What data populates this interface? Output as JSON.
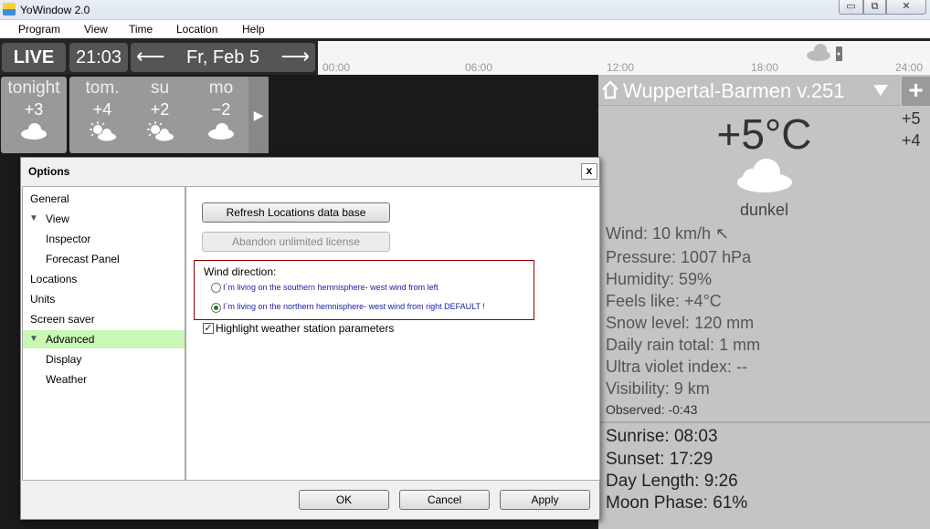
{
  "window": {
    "title": "YoWindow 2.0",
    "minimize": "▭",
    "maximize": "⧉",
    "close": "✕"
  },
  "menu": [
    "Program",
    "View",
    "Time",
    "Location",
    "Help"
  ],
  "controls": {
    "live": "LIVE",
    "time": "21:03",
    "date": "Fr, Feb 5",
    "prev_arrow": "⟵",
    "next_arrow": "⟶",
    "timeline_ticks": [
      "00:00",
      "06:00",
      "12:00",
      "18:00",
      "24:00"
    ]
  },
  "forecast": [
    {
      "name": "tonight",
      "temp": "+3",
      "icon": "cloud-icon"
    },
    {
      "name": "tom.",
      "temp": "+4",
      "icon": "sun-cloud-icon"
    },
    {
      "name": "su",
      "temp": "+2",
      "icon": "sun-cloud-icon"
    },
    {
      "name": "mo",
      "temp": "−2",
      "icon": "cloud-icon"
    }
  ],
  "forecast_next": "▶",
  "weather": {
    "location": "Wuppertal-Barmen v.251",
    "plus": "+",
    "side_temps": [
      "+5",
      "+4"
    ],
    "temperature": "+5°C",
    "description": "dunkel",
    "stats": [
      {
        "label": "Wind:",
        "value": "10 km/h ↖"
      },
      {
        "label": "Pressure:",
        "value": "1007 hPa"
      },
      {
        "label": "Humidity:",
        "value": "59%"
      },
      {
        "label": "Feels like:",
        "value": "+4°C"
      },
      {
        "label": "Snow level:",
        "value": "120 mm"
      },
      {
        "label": "Daily rain total:",
        "value": "1 mm"
      },
      {
        "label": "Ultra violet index:",
        "value": "--"
      },
      {
        "label": "Visibility:",
        "value": "9 km"
      }
    ],
    "observed": "Observed: -0:43",
    "sun": [
      {
        "label": "Sunrise:",
        "value": "08:03"
      },
      {
        "label": "Sunset:",
        "value": "17:29"
      },
      {
        "label": "Day Length:",
        "value": "9:26"
      },
      {
        "label": "Moon Phase:",
        "value": "61%"
      }
    ]
  },
  "dialog": {
    "title": "Options",
    "close": "x",
    "tree": [
      {
        "label": "General",
        "indent": 0,
        "expanded": false,
        "selected": false
      },
      {
        "label": "View",
        "indent": 0,
        "expanded": true,
        "selected": false
      },
      {
        "label": "Inspector",
        "indent": 1,
        "expanded": false,
        "selected": false
      },
      {
        "label": "Forecast Panel",
        "indent": 1,
        "expanded": false,
        "selected": false
      },
      {
        "label": "Locations",
        "indent": 0,
        "expanded": false,
        "selected": false
      },
      {
        "label": "Units",
        "indent": 0,
        "expanded": false,
        "selected": false
      },
      {
        "label": "Screen saver",
        "indent": 0,
        "expanded": false,
        "selected": false
      },
      {
        "label": "Advanced",
        "indent": 0,
        "expanded": true,
        "selected": true
      },
      {
        "label": "Display",
        "indent": 1,
        "expanded": false,
        "selected": false
      },
      {
        "label": "Weather",
        "indent": 1,
        "expanded": false,
        "selected": false
      }
    ],
    "refresh_btn": "Refresh Locations data base",
    "abandon_btn": "Abandon unlimited license",
    "wind_label": "Wind direction:",
    "radio_south": "I´m living on the southern hemnisphere- west wind from left",
    "radio_north": "I´m living on the northern hemnisphere- west wind from right  DEFAULT !",
    "highlight_label": "Highlight weather station parameters",
    "ok": "OK",
    "cancel": "Cancel",
    "apply": "Apply"
  }
}
